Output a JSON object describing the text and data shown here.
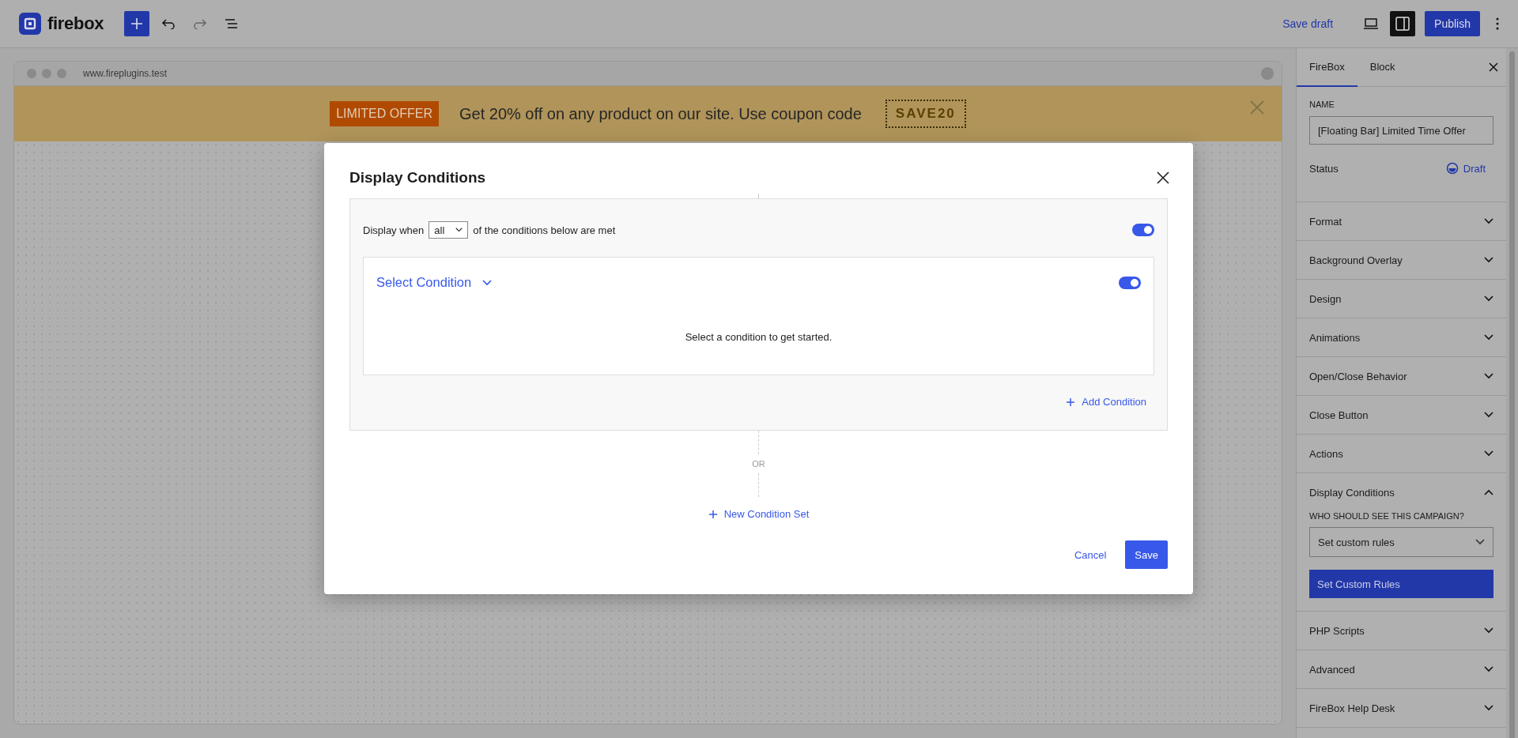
{
  "toolbar": {
    "logo_text": "firebox",
    "undo": {
      "disabled": false
    },
    "redo": {
      "disabled": true
    },
    "settings_toggle": {
      "pressed": true
    },
    "save_draft": "Save draft",
    "publish": "Publish"
  },
  "preview": {
    "url": "www.fireplugins.test",
    "banner": {
      "badge": "LIMITED OFFER",
      "message": "Get 20% off on any product on our site. Use coupon code",
      "coupon": "SAVE20"
    }
  },
  "modal": {
    "title": "Display Conditions",
    "condition_sets": [
      {
        "match_label": "Display when",
        "match_value": "all",
        "match_suffix": "of the conditions below are met",
        "enabled": true,
        "conditions": [
          {
            "label": "Select Condition",
            "enabled": true,
            "hint": "Select a condition to get started."
          }
        ],
        "add_button": "Add Condition"
      }
    ],
    "separator": "OR",
    "new_set_button": "New Condition Set",
    "cancel": "Cancel",
    "save": "Save"
  },
  "sidebar": {
    "tabs": [
      {
        "label": "FireBox",
        "selected": true
      },
      {
        "label": "Block",
        "selected": false
      }
    ],
    "name_label": "NAME",
    "name_value": "[Floating Bar] Limited Time Offer",
    "status_label": "Status",
    "status_value": "Draft",
    "panels": [
      {
        "title": "Format",
        "expanded": false
      },
      {
        "title": "Background Overlay",
        "expanded": false
      },
      {
        "title": "Design",
        "expanded": false
      },
      {
        "title": "Animations",
        "expanded": false
      },
      {
        "title": "Open/Close Behavior",
        "expanded": false
      },
      {
        "title": "Close Button",
        "expanded": false
      },
      {
        "title": "Actions",
        "expanded": false
      },
      {
        "title": "Display Conditions",
        "expanded": true,
        "question": "WHO SHOULD SEE THIS CAMPAIGN?",
        "select_value": "Set custom rules",
        "button": "Set Custom Rules"
      },
      {
        "title": "PHP Scripts",
        "expanded": false
      },
      {
        "title": "Advanced",
        "expanded": false
      },
      {
        "title": "FireBox Help Desk",
        "expanded": false
      }
    ]
  }
}
